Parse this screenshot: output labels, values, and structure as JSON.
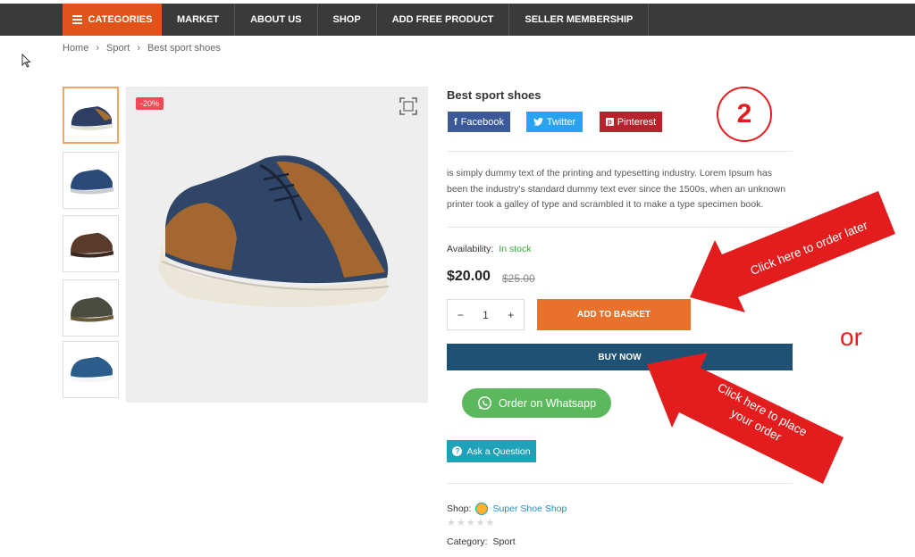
{
  "nav": {
    "categories_label": "CATEGORIES",
    "items": [
      "MARKET",
      "ABOUT US",
      "SHOP",
      "ADD FREE PRODUCT",
      "SELLER MEMBERSHIP"
    ]
  },
  "breadcrumb": [
    "Home",
    "Sport",
    "Best sport shoes"
  ],
  "gallery": {
    "discount_badge": "-20%",
    "thumb_colors": [
      "navy-brown",
      "navy-grey",
      "brown",
      "olive",
      "navy-white"
    ]
  },
  "product": {
    "title": "Best sport shoes",
    "share": {
      "facebook": "Facebook",
      "twitter": "Twitter",
      "pinterest": "Pinterest"
    },
    "description": " is simply dummy text of the printing and typesetting industry. Lorem Ipsum has been the industry's standard dummy text ever since the 1500s, when an unknown printer took a galley of type and scrambled it to make a type specimen book.",
    "availability_label": "Availability:",
    "availability_value": "In stock",
    "price": "$20.00",
    "old_price": "$25.00",
    "quantity": "1",
    "add_to_basket": "ADD TO BASKET",
    "buy_now": "BUY NOW",
    "whatsapp": "Order on Whatsapp",
    "ask_question": "Ask a Question",
    "shop_label": "Shop:",
    "shop_name": "Super Shoe Shop",
    "rating_stars": 0,
    "category_label": "Category:",
    "category_value": "Sport"
  },
  "annotations": {
    "step_number": "2",
    "order_later": "Click here to order later",
    "place_order_line1": "Click here to place",
    "place_order_line2": "your order",
    "or": "or"
  },
  "colors": {
    "accent_orange": "#e0541a",
    "basket_orange": "#e8722c",
    "buy_now_blue": "#1f5175",
    "whatsapp_green": "#5cb85c",
    "annotation_red": "#e31d1d"
  }
}
